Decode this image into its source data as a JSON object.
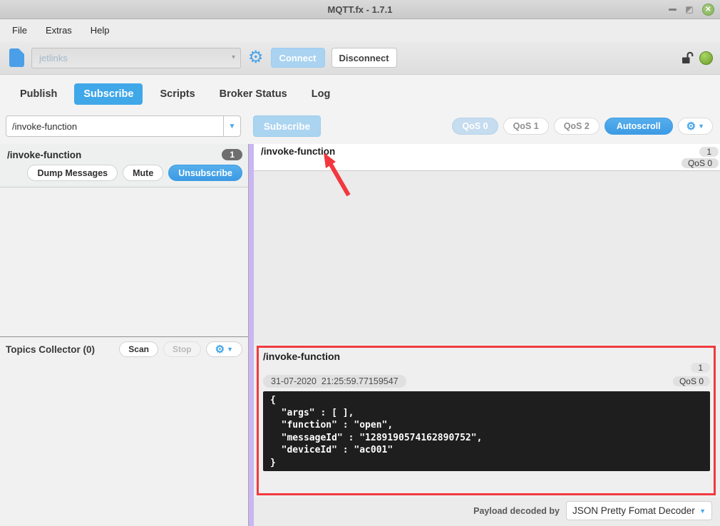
{
  "window": {
    "title": "MQTT.fx - 1.7.1",
    "close_glyph": "✕"
  },
  "menu": {
    "items": [
      "File",
      "Extras",
      "Help"
    ]
  },
  "connection": {
    "profile": "jetlinks",
    "connect_label": "Connect",
    "disconnect_label": "Disconnect"
  },
  "tabs": {
    "items": [
      "Publish",
      "Subscribe",
      "Scripts",
      "Broker Status",
      "Log"
    ],
    "active": "Subscribe"
  },
  "subscribe_bar": {
    "topic_value": "/invoke-function",
    "subscribe_label": "Subscribe",
    "qos_buttons": [
      "QoS 0",
      "QoS 1",
      "QoS 2"
    ],
    "qos_selected": "QoS 0",
    "autoscroll_label": "Autoscroll"
  },
  "subscription": {
    "topic": "/invoke-function",
    "count": "1",
    "dump_label": "Dump Messages",
    "mute_label": "Mute",
    "unsubscribe_label": "Unsubscribe"
  },
  "topics_collector": {
    "title": "Topics Collector (0)",
    "scan_label": "Scan",
    "stop_label": "Stop"
  },
  "message_list": {
    "topic": "/invoke-function",
    "count": "1",
    "qos": "QoS 0"
  },
  "message_detail": {
    "topic": "/invoke-function",
    "count": "1",
    "timestamp": "31-07-2020  21:25:59.77159547",
    "qos": "QoS 0",
    "payload": "{\n  \"args\" : [ ],\n  \"function\" : \"open\",\n  \"messageId\" : \"1289190574162890752\",\n  \"deviceId\" : \"ac001\"\n}"
  },
  "decoder": {
    "label": "Payload decoded by",
    "value": "JSON Pretty Fomat Decoder"
  },
  "icons": {
    "gear": "⚙",
    "caret_down": "▼",
    "combo_caret": "▾"
  },
  "colors": {
    "accent_blue": "#40a7e9",
    "disabled_blue": "#abd4f1",
    "annotation_red": "#f03a40",
    "status_green": "#7faf3c",
    "lavender": "#c9b6f3",
    "payload_bg": "#1e1e1e"
  }
}
